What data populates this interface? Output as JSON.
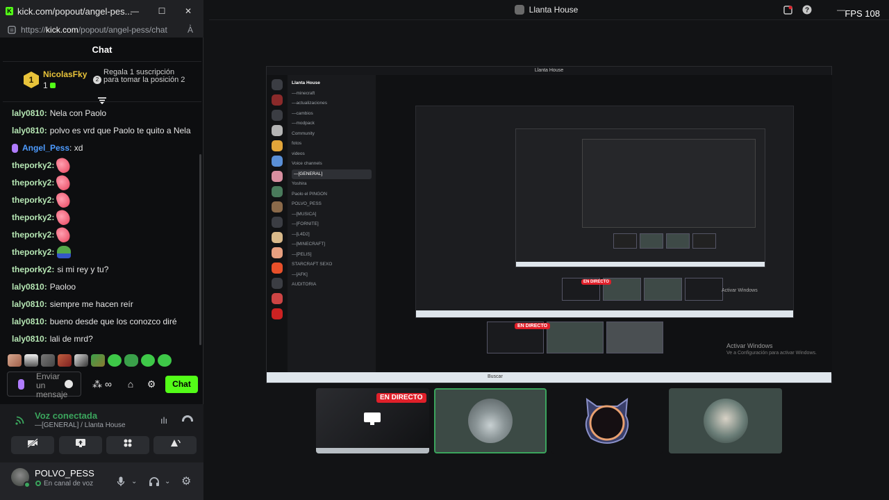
{
  "browser": {
    "tab_title": "kick.com/popout/angel-pes...",
    "url_prefix": "https://",
    "url_host": "kick.com",
    "url_path": "/popout/angel-pess/chat"
  },
  "chat": {
    "header": "Chat",
    "leader": {
      "rank": "1",
      "name": "NicolasFky",
      "count": "1",
      "gift_badge": "2",
      "gift_text": "Regala 1 suscripción para tomar la posición 2"
    },
    "messages": [
      {
        "user": "laly0810:",
        "text": "Nela con Paolo",
        "color": "green"
      },
      {
        "user": "laly0810:",
        "text": "polvo es vrd que Paolo te quito a Nela",
        "color": "green"
      },
      {
        "user": "Angel_Pess",
        "text": ": xd",
        "color": "blue"
      },
      {
        "user": "theporky2:",
        "text": "",
        "color": "green",
        "emote": "heart"
      },
      {
        "user": "theporky2:",
        "text": "",
        "color": "green",
        "emote": "heart"
      },
      {
        "user": "theporky2:",
        "text": "",
        "color": "green",
        "emote": "heart"
      },
      {
        "user": "theporky2:",
        "text": "",
        "color": "green",
        "emote": "heart"
      },
      {
        "user": "theporky2:",
        "text": "",
        "color": "green",
        "emote": "heart"
      },
      {
        "user": "theporky2:",
        "text": "",
        "color": "green",
        "emote": "pepe"
      },
      {
        "user": "theporky2:",
        "text": "si mi rey y tu?",
        "color": "green"
      },
      {
        "user": "laly0810:",
        "text": "Paoloo",
        "color": "green"
      },
      {
        "user": "laly0810:",
        "text": "siempre me hacen reír",
        "color": "green"
      },
      {
        "user": "laly0810:",
        "text": "bueno desde que los conozco diré",
        "color": "green"
      },
      {
        "user": "laly0810:",
        "text": "lali de mrd?",
        "color": "green"
      }
    ],
    "input_placeholder": "Enviar un mensaje",
    "send_label": "Chat"
  },
  "voice": {
    "status": "Voz conectada",
    "channel": "—[GENERAL] / Llanta House"
  },
  "user": {
    "name": "POLVO_PESS",
    "status": "En canal de voz"
  },
  "stage": {
    "server_name": "Llanta House",
    "fps": "FPS 108",
    "live_badge": "EN DIRECTO"
  },
  "nested": {
    "title": "Llanta House",
    "server_header": "Llanta House",
    "channels": [
      "—minecraft",
      "—actualizaciones",
      "—cambios",
      "—modpack",
      "Community",
      "fotos",
      "videos",
      "Voice channels",
      "—[GENERAL]",
      "Yoshira",
      "Paolo el PINGON",
      "POLVO_PESS",
      "—[MUSICA]",
      "—[FORNITE]",
      "—[L4D2]",
      "—[MINECRAFT]",
      "—[PELIS]",
      "STARCRAFT SEXO",
      "—[AFK]",
      "AUDITORIA"
    ],
    "live_badge": "EN DIRECTO",
    "watermark_title": "Activar Windows",
    "watermark_sub": "Ve a Configuración para activar Windows.",
    "search": "Buscar"
  },
  "colors": {
    "kick_green": "#53fc18",
    "voice_green": "#3ba55d",
    "live_red": "#e0202a",
    "leader_gold": "#e8c33a"
  }
}
